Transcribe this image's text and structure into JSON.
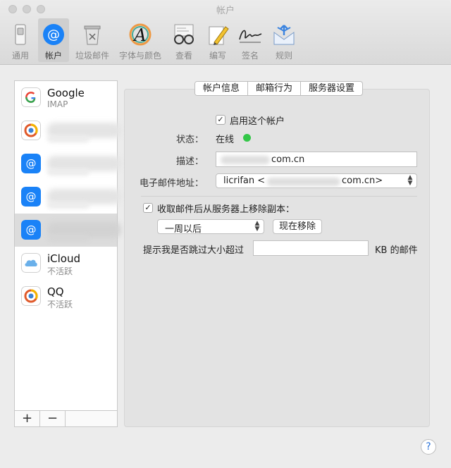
{
  "window": {
    "title": "帐户"
  },
  "toolbar": {
    "items": [
      {
        "label": "通用",
        "icon": "switch-icon"
      },
      {
        "label": "帐户",
        "icon": "at-icon"
      },
      {
        "label": "垃圾邮件",
        "icon": "trash-icon"
      },
      {
        "label": "字体与颜色",
        "icon": "font-color-icon"
      },
      {
        "label": "查看",
        "icon": "glasses-icon"
      },
      {
        "label": "编写",
        "icon": "pencil-icon"
      },
      {
        "label": "签名",
        "icon": "signature-icon"
      },
      {
        "label": "规则",
        "icon": "rules-icon"
      }
    ]
  },
  "sidebar": {
    "accounts": [
      {
        "name": "Google",
        "sub": "IMAP"
      },
      {
        "name": "",
        "sub": ""
      },
      {
        "name": "",
        "sub": ""
      },
      {
        "name": "",
        "sub": ""
      },
      {
        "name": "",
        "sub": ""
      },
      {
        "name": "iCloud",
        "sub": "不活跃"
      },
      {
        "name": "QQ",
        "sub": "不活跃"
      }
    ],
    "add_label": "+",
    "remove_label": "−"
  },
  "tabs": [
    "帐户信息",
    "邮箱行为",
    "服务器设置"
  ],
  "form": {
    "enable_label": "启用这个帐户",
    "status_label": "状态：",
    "status_value": "在线",
    "status_color": "#33c748",
    "desc_label": "描述：",
    "desc_value_suffix": "com.cn",
    "email_label": "电子邮件地址：",
    "email_prefix": "licrifan <",
    "email_suffix": "com.cn>",
    "remove_copy_label": "收取邮件后从服务器上移除副本：",
    "remove_period": "一周以后",
    "remove_now": "现在移除",
    "prompt_label": "提示我是否跳过大小超过",
    "prompt_unit": "KB 的邮件"
  },
  "help_label": "?",
  "colors": {
    "accent": "#1a82f7"
  }
}
